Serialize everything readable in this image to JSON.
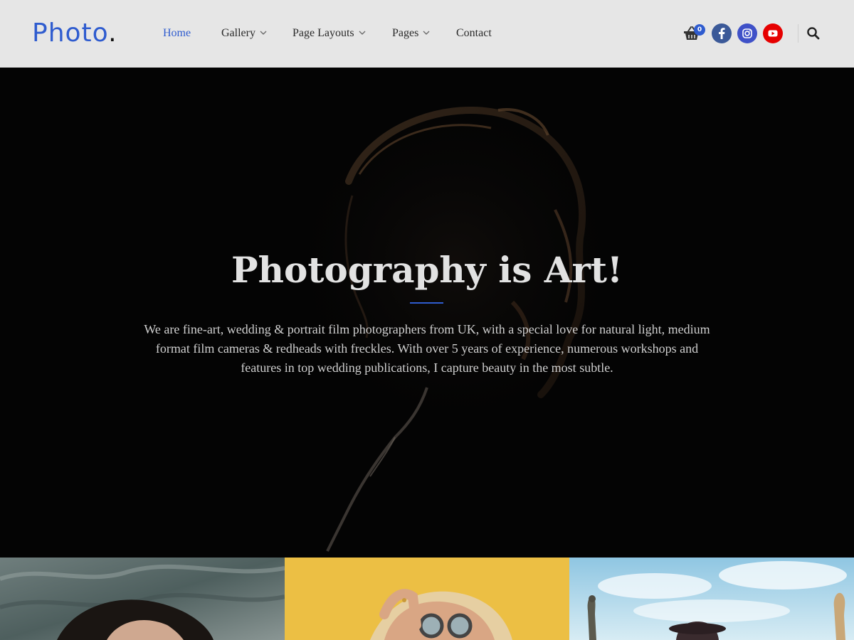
{
  "brand": {
    "name": "Photo",
    "dot": "."
  },
  "nav": [
    {
      "label": "Home",
      "active": true
    },
    {
      "label": "Gallery",
      "dropdown": true
    },
    {
      "label": "Page Layouts",
      "dropdown": true
    },
    {
      "label": "Pages",
      "dropdown": true
    },
    {
      "label": "Contact"
    }
  ],
  "cart": {
    "icon": "shopping-basket-icon",
    "count": "0"
  },
  "social": [
    {
      "name": "facebook-icon",
      "color": "#3b5998"
    },
    {
      "name": "instagram-icon",
      "color": "#3f51c8"
    },
    {
      "name": "youtube-icon",
      "color": "#e60000"
    }
  ],
  "search": {
    "icon": "search-icon"
  },
  "hero": {
    "title": "Photography is Art!",
    "text": "We are fine-art, wedding & portrait film photographers from UK, with a special love for natural light, medium format film cameras & redheads with freckles. With over 5 years of experience, numerous workshops and features in top wedding publications, I capture beauty in the most subtle."
  },
  "colors": {
    "accent": "#2f5ccf",
    "header_bg": "#e6e6e6",
    "hero_bg": "#040404"
  }
}
